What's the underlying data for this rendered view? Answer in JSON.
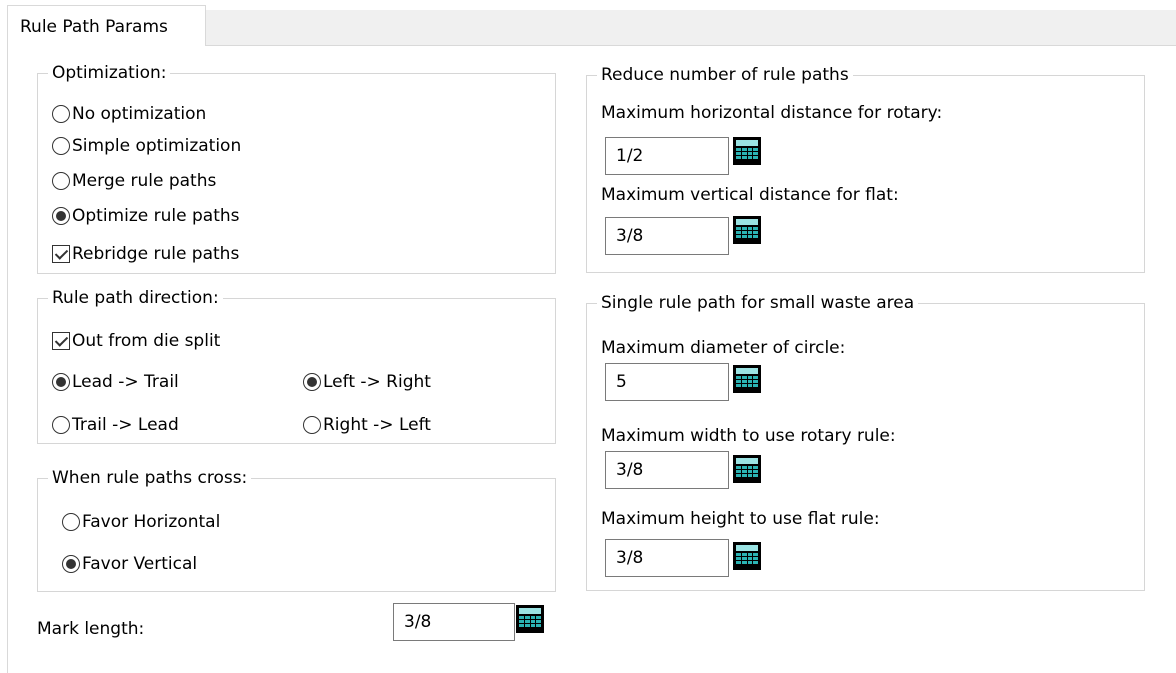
{
  "tab": {
    "label": "Rule Path Params"
  },
  "optimization": {
    "title": "Optimization:",
    "options": [
      "No optimization",
      "Simple optimization",
      "Merge rule paths",
      "Optimize rule paths"
    ],
    "selected": "Optimize rule paths",
    "rebridge_label": "Rebridge rule paths",
    "rebridge_checked": true
  },
  "direction": {
    "title": "Rule path direction:",
    "out_from_label": "Out from die split",
    "out_from_checked": true,
    "lead_trail": [
      "Lead -> Trail",
      "Trail -> Lead"
    ],
    "lead_trail_selected": "Lead -> Trail",
    "left_right": [
      "Left -> Right",
      "Right -> Left"
    ],
    "left_right_selected": "Left -> Right"
  },
  "cross": {
    "title": "When rule paths cross:",
    "options": [
      "Favor Horizontal",
      "Favor Vertical"
    ],
    "selected": "Favor Vertical"
  },
  "mark": {
    "label": "Mark length:",
    "value": "3/8"
  },
  "reduce": {
    "title": "Reduce number of rule paths",
    "rotary_label": "Maximum horizontal distance for rotary:",
    "rotary_value": "1/2",
    "flat_label": "Maximum vertical distance for flat:",
    "flat_value": "3/8"
  },
  "single": {
    "title": "Single rule path for small waste area",
    "circle_label": "Maximum diameter of circle:",
    "circle_value": "5",
    "width_label": "Maximum width to use rotary rule:",
    "width_value": "3/8",
    "height_label": "Maximum height to use flat rule:",
    "height_value": "3/8"
  },
  "icons": {
    "calculator": "calculator-icon"
  }
}
